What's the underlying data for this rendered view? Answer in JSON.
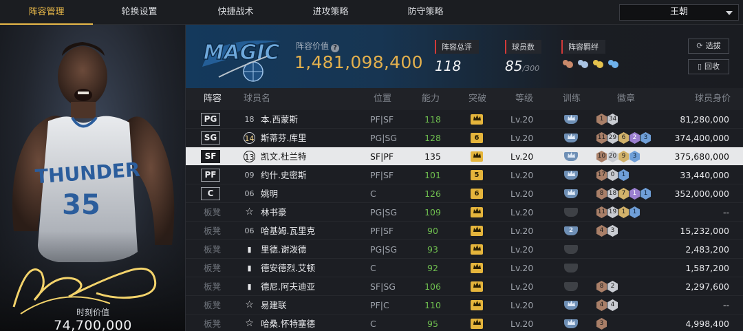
{
  "nav": {
    "tabs": [
      "阵容管理",
      "轮换设置",
      "快捷战术",
      "进攻策略",
      "防守策略"
    ],
    "active_tab": 0,
    "team_select": "王朝"
  },
  "player_card": {
    "jersey_team": "THUNDER",
    "jersey_number": "35",
    "value_label": "时刻价值",
    "value": "74,700,000"
  },
  "summary": {
    "team_logo_text": "MAGIC",
    "value_label": "阵容价值",
    "value": "1,481,098,400",
    "rating_label": "阵容总评",
    "rating": "118",
    "players_label": "球员数",
    "players_count": "85",
    "players_max": "/300",
    "chemistry_label": "阵容羁绊",
    "buttons": {
      "select": "选拔",
      "recycle": "回收"
    }
  },
  "table": {
    "headers": [
      "阵容",
      "球员名",
      "位置",
      "能力",
      "突破",
      "等级",
      "训练",
      "徽章",
      "球员身价"
    ],
    "rows": [
      {
        "slot": "PG",
        "slot_type": "starter",
        "num": "18",
        "num_style": "plain",
        "name": "本.西蒙斯",
        "position": "PF|SF",
        "ability": "118",
        "breakthrough": "crown",
        "level": "Lv.20",
        "training": "crown",
        "badges": [
          [
            "bronze",
            "1"
          ],
          [
            "silver",
            "34"
          ]
        ],
        "salary": "81,280,000"
      },
      {
        "slot": "SG",
        "slot_type": "starter",
        "num": "14",
        "num_style": "circle",
        "name": "斯蒂芬.库里",
        "position": "PG|SG",
        "ability": "128",
        "breakthrough": "6",
        "level": "Lv.20",
        "training": "crown",
        "badges": [
          [
            "bronze",
            "11"
          ],
          [
            "silver",
            "29"
          ],
          [
            "gold",
            "6"
          ],
          [
            "purple",
            "2"
          ],
          [
            "blue",
            "3"
          ]
        ],
        "salary": "374,400,000"
      },
      {
        "slot": "SF",
        "slot_type": "starter",
        "num": "13",
        "num_style": "circle",
        "name": "凯文.杜兰特",
        "position": "SF|PF",
        "ability": "135",
        "breakthrough": "crown",
        "level": "Lv.20",
        "training": "crown",
        "badges": [
          [
            "bronze",
            "10"
          ],
          [
            "silver",
            "20"
          ],
          [
            "gold",
            "9"
          ],
          [
            "blue",
            "3"
          ]
        ],
        "salary": "375,680,000",
        "selected": true
      },
      {
        "slot": "PF",
        "slot_type": "starter",
        "num": "09",
        "num_style": "plain",
        "name": "约什.史密斯",
        "position": "PF|SF",
        "ability": "101",
        "breakthrough": "5",
        "level": "Lv.20",
        "training": "crown",
        "badges": [
          [
            "bronze",
            "17"
          ],
          [
            "silver",
            "0"
          ],
          [
            "blue",
            "1"
          ]
        ],
        "salary": "33,440,000"
      },
      {
        "slot": "C",
        "slot_type": "starter",
        "num": "06",
        "num_style": "plain",
        "name": "姚明",
        "position": "C",
        "ability": "126",
        "breakthrough": "6",
        "level": "Lv.20",
        "training": "crown",
        "badges": [
          [
            "bronze",
            "8"
          ],
          [
            "silver",
            "18"
          ],
          [
            "gold",
            "7"
          ],
          [
            "purple",
            "1"
          ],
          [
            "blue",
            "1"
          ]
        ],
        "salary": "352,000,000"
      },
      {
        "slot": "板凳",
        "slot_type": "bench",
        "num": "☆",
        "num_style": "star",
        "name": "林书豪",
        "position": "PG|SG",
        "ability": "109",
        "breakthrough": "crown",
        "level": "Lv.20",
        "training": "dark",
        "badges": [
          [
            "bronze",
            "11"
          ],
          [
            "silver",
            "19"
          ],
          [
            "gold",
            "1"
          ],
          [
            "blue",
            "1"
          ]
        ],
        "salary": "--"
      },
      {
        "slot": "板凳",
        "slot_type": "bench",
        "num": "06",
        "num_style": "plain",
        "name": "哈基姆.瓦里克",
        "position": "PF|SF",
        "ability": "90",
        "breakthrough": "crown",
        "level": "Lv.20",
        "training": "2",
        "badges": [
          [
            "bronze",
            "4"
          ],
          [
            "silver",
            "3"
          ]
        ],
        "salary": "15,232,000"
      },
      {
        "slot": "板凳",
        "slot_type": "bench",
        "num": "▮",
        "num_style": "bars",
        "name": "里德.谢泼德",
        "position": "PG|SG",
        "ability": "93",
        "breakthrough": "crown",
        "level": "Lv.20",
        "training": "dark",
        "badges": [],
        "salary": "2,483,200"
      },
      {
        "slot": "板凳",
        "slot_type": "bench",
        "num": "▮",
        "num_style": "bars",
        "name": "德安德烈.艾顿",
        "position": "C",
        "ability": "92",
        "breakthrough": "crown",
        "level": "Lv.20",
        "training": "dark",
        "badges": [],
        "salary": "1,587,200"
      },
      {
        "slot": "板凳",
        "slot_type": "bench",
        "num": "▮",
        "num_style": "bars",
        "name": "德尼.阿夫迪亚",
        "position": "SF|SG",
        "ability": "106",
        "breakthrough": "crown",
        "level": "Lv.20",
        "training": "dark",
        "badges": [
          [
            "bronze",
            "8"
          ],
          [
            "silver",
            "2"
          ]
        ],
        "salary": "2,297,600"
      },
      {
        "slot": "板凳",
        "slot_type": "bench",
        "num": "☆",
        "num_style": "star",
        "name": "易建联",
        "position": "PF|C",
        "ability": "110",
        "breakthrough": "crown",
        "level": "Lv.20",
        "training": "crown",
        "badges": [
          [
            "bronze",
            "4"
          ],
          [
            "silver",
            "4"
          ]
        ],
        "salary": "--"
      },
      {
        "slot": "板凳",
        "slot_type": "bench",
        "num": "☆",
        "num_style": "star",
        "name": "哈桑.怀特塞德",
        "position": "C",
        "ability": "95",
        "breakthrough": "crown",
        "level": "Lv.20",
        "training": "crown",
        "badges": [
          [
            "bronze",
            "3"
          ]
        ],
        "salary": "4,998,400"
      }
    ]
  },
  "colors": {
    "accent": "#e9b949",
    "value_gold": "#e3b04d",
    "ability_green": "#6fbf4f",
    "label_red": "#d23a3a"
  }
}
